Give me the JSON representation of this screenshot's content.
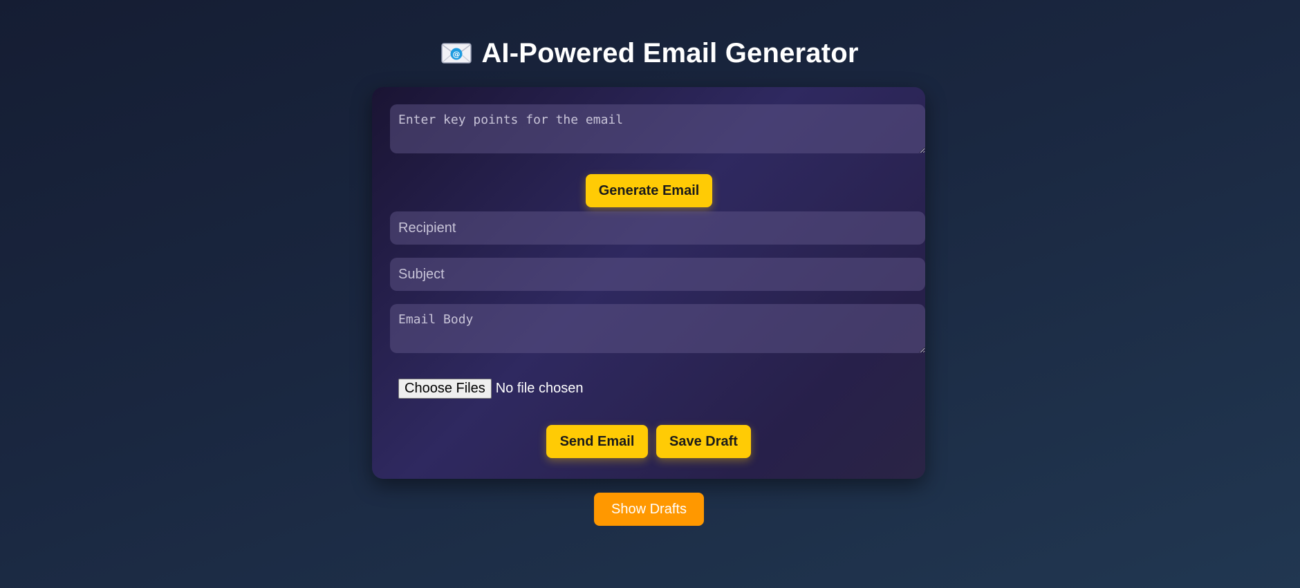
{
  "header": {
    "title": "AI-Powered Email Generator",
    "icon": "envelope-with-at-icon"
  },
  "composer": {
    "keypoints_placeholder": "Enter key points for the email",
    "generate_label": "Generate Email",
    "recipient_placeholder": "Recipient",
    "subject_placeholder": "Subject",
    "body_placeholder": "Email Body",
    "file_button_label": "Choose Files",
    "file_status": "No file chosen",
    "send_label": "Send Email",
    "save_draft_label": "Save Draft"
  },
  "footer": {
    "show_drafts_label": "Show Drafts"
  },
  "colors": {
    "accent_yellow": "#ffcb05",
    "accent_orange": "#ff9800",
    "card_purple": "#2f2960",
    "background": "#1a2740"
  }
}
